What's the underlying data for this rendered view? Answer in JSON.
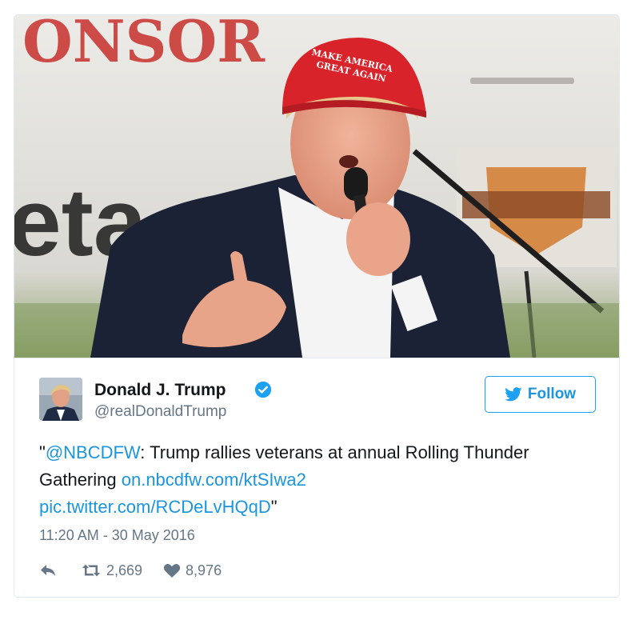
{
  "media": {
    "cap_text_line1": "MAKE AMERICA",
    "cap_text_line2": "GREAT AGAIN",
    "banner_text": "ONSOR",
    "sign_text": "eta"
  },
  "tweet": {
    "author_name": "Donald J. Trump",
    "author_handle": "@realDonaldTrump",
    "follow_label": "Follow",
    "text_open_quote": "\"",
    "text_mention": "@NBCDFW",
    "text_body": ": Trump rallies veterans at annual Rolling Thunder Gathering ",
    "text_link": "on.nbcdfw.com/ktSIwa2",
    "text_pic_link": "pic.twitter.com/RCDeLvHQqD",
    "text_close_quote": "\"",
    "timestamp": "11:20 AM - 30 May 2016",
    "retweet_count": "2,669",
    "like_count": "8,976"
  },
  "colors": {
    "link": "#1b95e0",
    "border": "#e1e8ed",
    "muted": "#657786",
    "verified": "#1da1f2"
  },
  "icons": [
    "verified-badge-icon",
    "twitter-bird-icon",
    "reply-icon",
    "retweet-icon",
    "heart-icon"
  ]
}
